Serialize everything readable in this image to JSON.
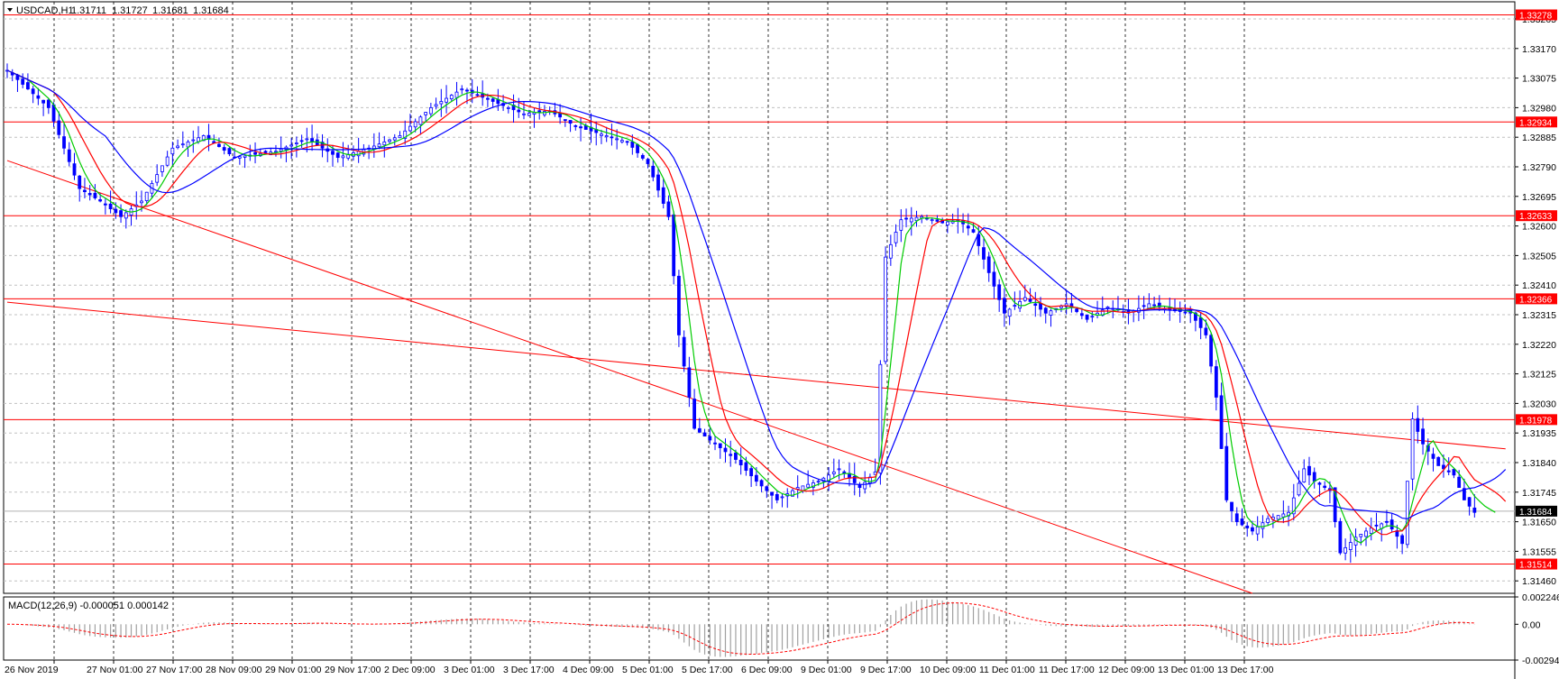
{
  "chart_data": {
    "type": "candlestick",
    "symbol_header": "USDCAD,H1",
    "ohlc_last": [
      "1.31711",
      "1.31727",
      "1.31681",
      "1.31684"
    ],
    "y_ticks": [
      "1.33265",
      "1.33170",
      "1.33075",
      "1.32980",
      "1.32885",
      "1.32790",
      "1.32695",
      "1.32600",
      "1.32505",
      "1.32410",
      "1.32315",
      "1.32220",
      "1.32125",
      "1.32030",
      "1.31935",
      "1.31840",
      "1.31745",
      "1.31650",
      "1.31555",
      "1.31460"
    ],
    "ylim": [
      1.3142,
      1.3332
    ],
    "x_ticks": [
      "26 Nov 2019",
      "27 Nov 01:00",
      "27 Nov 17:00",
      "28 Nov 09:00",
      "29 Nov 01:00",
      "29 Nov 17:00",
      "2 Dec 09:00",
      "3 Dec 01:00",
      "3 Dec 17:00",
      "4 Dec 09:00",
      "5 Dec 01:00",
      "5 Dec 17:00",
      "6 Dec 09:00",
      "9 Dec 01:00",
      "9 Dec 17:00",
      "10 Dec 09:00",
      "11 Dec 01:00",
      "11 Dec 17:00",
      "12 Dec 09:00",
      "13 Dec 01:00",
      "13 Dec 17:00"
    ],
    "horizontal_levels": [
      {
        "value": 1.33278,
        "label": "1.33278"
      },
      {
        "value": 1.32934,
        "label": "1.32934"
      },
      {
        "value": 1.32633,
        "label": "1.32633"
      },
      {
        "value": 1.32366,
        "label": "1.32366"
      },
      {
        "value": 1.31978,
        "label": "1.31978"
      },
      {
        "value": 1.31514,
        "label": "1.31514"
      }
    ],
    "current_price": {
      "value": 1.31684,
      "label": "1.31684"
    },
    "close_path": [
      [
        0,
        1.331
      ],
      [
        8,
        1.3298
      ],
      [
        14,
        1.3272
      ],
      [
        18,
        1.3268
      ],
      [
        22,
        1.3263
      ],
      [
        26,
        1.3268
      ],
      [
        32,
        1.3285
      ],
      [
        38,
        1.3289
      ],
      [
        44,
        1.3282
      ],
      [
        52,
        1.3284
      ],
      [
        58,
        1.3288
      ],
      [
        64,
        1.3282
      ],
      [
        70,
        1.3285
      ],
      [
        76,
        1.3289
      ],
      [
        82,
        1.3298
      ],
      [
        88,
        1.3304
      ],
      [
        94,
        1.33
      ],
      [
        100,
        1.3296
      ],
      [
        105,
        1.3297
      ],
      [
        110,
        1.3292
      ],
      [
        116,
        1.3289
      ],
      [
        120,
        1.3287
      ],
      [
        124,
        1.328
      ],
      [
        128,
        1.3263
      ],
      [
        130,
        1.3225
      ],
      [
        133,
        1.3195
      ],
      [
        137,
        1.319
      ],
      [
        141,
        1.3185
      ],
      [
        145,
        1.3178
      ],
      [
        149,
        1.3172
      ],
      [
        153,
        1.3176
      ],
      [
        157,
        1.3178
      ],
      [
        161,
        1.3182
      ],
      [
        165,
        1.3176
      ],
      [
        168,
        1.3181
      ],
      [
        170,
        1.325
      ],
      [
        173,
        1.3262
      ],
      [
        177,
        1.3263
      ],
      [
        181,
        1.3261
      ],
      [
        184,
        1.3262
      ],
      [
        187,
        1.3258
      ],
      [
        190,
        1.3245
      ],
      [
        193,
        1.3232
      ],
      [
        197,
        1.3237
      ],
      [
        201,
        1.3232
      ],
      [
        205,
        1.3235
      ],
      [
        209,
        1.323
      ],
      [
        213,
        1.3234
      ],
      [
        217,
        1.3232
      ],
      [
        221,
        1.3235
      ],
      [
        225,
        1.3233
      ],
      [
        229,
        1.3232
      ],
      [
        232,
        1.3225
      ],
      [
        234,
        1.3205
      ],
      [
        236,
        1.3172
      ],
      [
        238,
        1.3165
      ],
      [
        241,
        1.3162
      ],
      [
        244,
        1.3166
      ],
      [
        248,
        1.3168
      ],
      [
        251,
        1.3182
      ],
      [
        253,
        1.3178
      ],
      [
        256,
        1.3175
      ],
      [
        258,
        1.3155
      ],
      [
        261,
        1.316
      ],
      [
        264,
        1.3163
      ],
      [
        267,
        1.3165
      ],
      [
        270,
        1.3158
      ],
      [
        272,
        1.3198
      ],
      [
        274,
        1.319
      ],
      [
        277,
        1.3183
      ],
      [
        280,
        1.318
      ],
      [
        282,
        1.3172
      ],
      [
        284,
        1.3168
      ]
    ],
    "total_bars": 290,
    "moving_averages": [
      {
        "color": "#00cc00",
        "period": 5
      },
      {
        "color": "#ff0000",
        "period": 10
      },
      {
        "color": "#0000ff",
        "period": 20
      }
    ],
    "trendlines": [
      {
        "from": [
          0,
          1.3281
        ],
        "to": [
          241,
          1.3142
        ],
        "color": "#ff0000"
      },
      {
        "from": [
          0,
          1.32355
        ],
        "to": [
          290,
          1.31884
        ],
        "color": "#ff0000"
      }
    ],
    "macd": {
      "label": "MACD(12,26,9) -0.000051 0.000142",
      "y_ticks": [
        "0.002246",
        "0.00",
        "-0.00294"
      ],
      "ylim": [
        -0.00294,
        0.002246
      ]
    },
    "colors": {
      "candle": "#0000ff",
      "grid": "#c0c0c0",
      "level": "#ff0000",
      "level_badge": "#ff0000",
      "current_badge": "#000000",
      "macd_signal": "#ff0000",
      "macd_hist": "#a0a0a0"
    }
  }
}
